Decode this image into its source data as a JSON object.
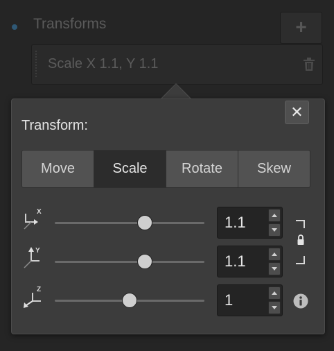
{
  "background": {
    "section_title": "Transforms",
    "add_label": "+",
    "transform_item_label": "Scale X 1.1, Y 1.1"
  },
  "popover": {
    "title": "Transform:",
    "close_label": "✕",
    "tabs": [
      {
        "label": "Move",
        "active": false
      },
      {
        "label": "Scale",
        "active": true
      },
      {
        "label": "Rotate",
        "active": false
      },
      {
        "label": "Skew",
        "active": false
      }
    ],
    "axes": [
      {
        "axis": "X",
        "value": "1.1",
        "slider_fraction": 0.6
      },
      {
        "axis": "Y",
        "value": "1.1",
        "slider_fraction": 0.6
      },
      {
        "axis": "Z",
        "value": "1",
        "slider_fraction": 0.5
      }
    ],
    "lock_linked": true
  },
  "colors": {
    "accent_dot": "#2f5875",
    "active_tab": "#2c2c2c",
    "inactive_tab": "#525252"
  }
}
